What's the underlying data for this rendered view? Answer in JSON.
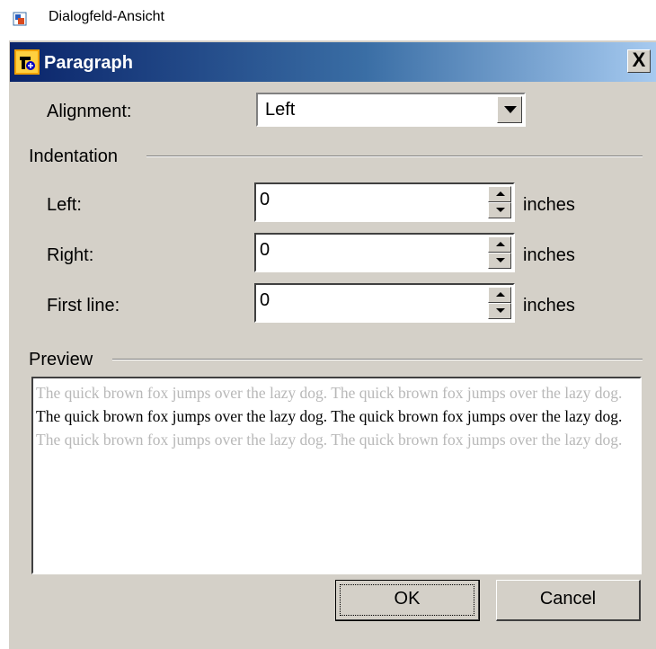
{
  "window": {
    "title": "Dialogfeld-Ansicht",
    "icon": "app-icon"
  },
  "dialog": {
    "title": "Paragraph",
    "close_label": "X",
    "alignment_label": "Alignment:",
    "alignment_value": "Left",
    "indentation_group": "Indentation",
    "left_label": "Left:",
    "left_value": "0",
    "right_label": "Right:",
    "right_value": "0",
    "first_line_label": "First line:",
    "first_line_value": "0",
    "unit": "inches",
    "preview_group": "Preview",
    "preview_before": "The quick brown fox jumps over the lazy dog. The quick brown fox jumps over the lazy dog.",
    "preview_current": "The quick brown fox jumps over the lazy dog. The quick brown fox jumps over the lazy dog.",
    "preview_after": "The quick brown fox jumps over the lazy dog. The quick brown fox jumps over the lazy dog.",
    "ok_label": "OK",
    "cancel_label": "Cancel"
  },
  "colors": {
    "titlebar_start": "#0a246a",
    "titlebar_end": "#a6caf0",
    "dialog_bg": "#d4d0c8"
  }
}
